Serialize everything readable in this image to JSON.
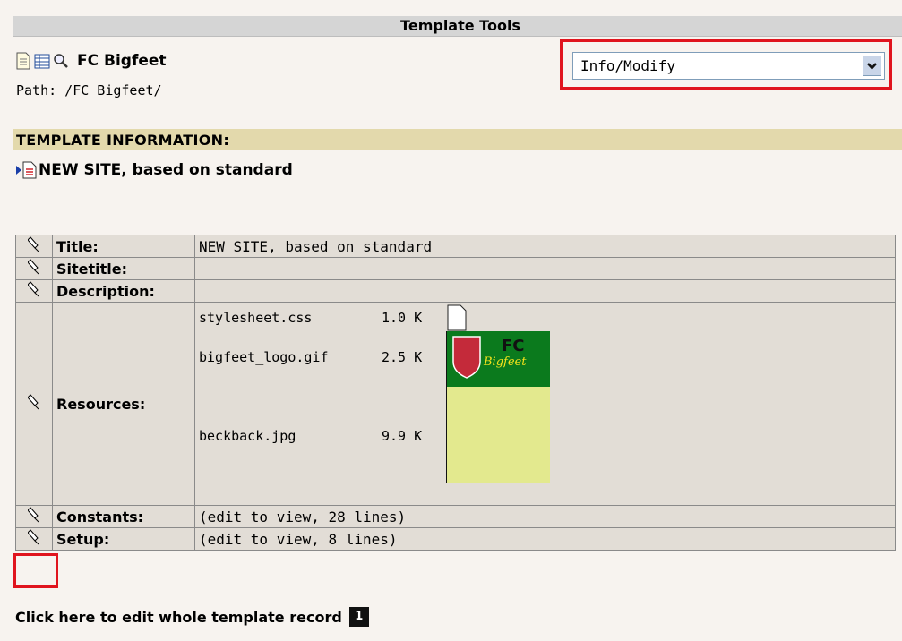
{
  "header": {
    "title": "Template Tools"
  },
  "page": {
    "title": "FC Bigfeet",
    "path": "Path: /FC Bigfeet/"
  },
  "mode_select": {
    "value": "Info/Modify"
  },
  "section": {
    "title": "TEMPLATE INFORMATION:"
  },
  "template": {
    "name": "NEW SITE, based on standard"
  },
  "table": {
    "rows": [
      {
        "label": "Title:",
        "value": "NEW SITE, based on standard"
      },
      {
        "label": "Sitetitle:",
        "value": ""
      },
      {
        "label": "Description:",
        "value": ""
      },
      {
        "label": "Resources:",
        "value": ""
      },
      {
        "label": "Constants:",
        "value": "(edit to view, 28 lines)"
      },
      {
        "label": "Setup:",
        "value": "(edit to view, 8 lines)"
      }
    ],
    "resources": [
      {
        "name": "stylesheet.css",
        "size": "1.0 K"
      },
      {
        "name": "bigfeet_logo.gif",
        "size": "2.5 K"
      },
      {
        "name": "beckback.jpg",
        "size": "9.9 K"
      }
    ]
  },
  "footer": {
    "link": "Click here to edit whole template record",
    "badge": "1"
  },
  "colors": {
    "highlight": "#e0141e",
    "section_bg": "#e3d9ac",
    "header_bg": "#d5d5d5",
    "table_bg": "#e2ddd6"
  }
}
